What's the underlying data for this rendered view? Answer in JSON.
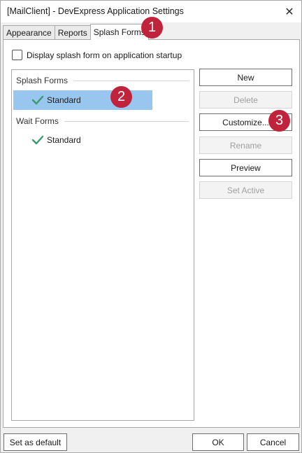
{
  "window": {
    "title": "[MailClient] - DevExpress Application Settings",
    "close_glyph": "✕"
  },
  "tabs": [
    {
      "label": "Appearance",
      "active": false
    },
    {
      "label": "Reports",
      "active": false
    },
    {
      "label": "Splash Forms",
      "active": true
    }
  ],
  "startup_checkbox": {
    "label": "Display splash form on application startup",
    "checked": false
  },
  "forms_list": {
    "groups": [
      {
        "header": "Splash Forms",
        "items": [
          {
            "label": "Standard",
            "selected": true,
            "icon": "checkmark-icon"
          }
        ]
      },
      {
        "header": "Wait Forms",
        "items": [
          {
            "label": "Standard",
            "selected": false,
            "icon": "checkmark-icon"
          }
        ]
      }
    ]
  },
  "actions": {
    "new": "New",
    "delete": "Delete",
    "customize": "Customize...",
    "rename": "Rename",
    "preview": "Preview",
    "set_active": "Set Active"
  },
  "footer": {
    "set_default": "Set as default",
    "ok": "OK",
    "cancel": "Cancel"
  },
  "callouts": [
    "1",
    "2",
    "3"
  ],
  "colors": {
    "selection": "#99c6ef",
    "callout": "#c0243c",
    "check": "#3a9a6a"
  }
}
